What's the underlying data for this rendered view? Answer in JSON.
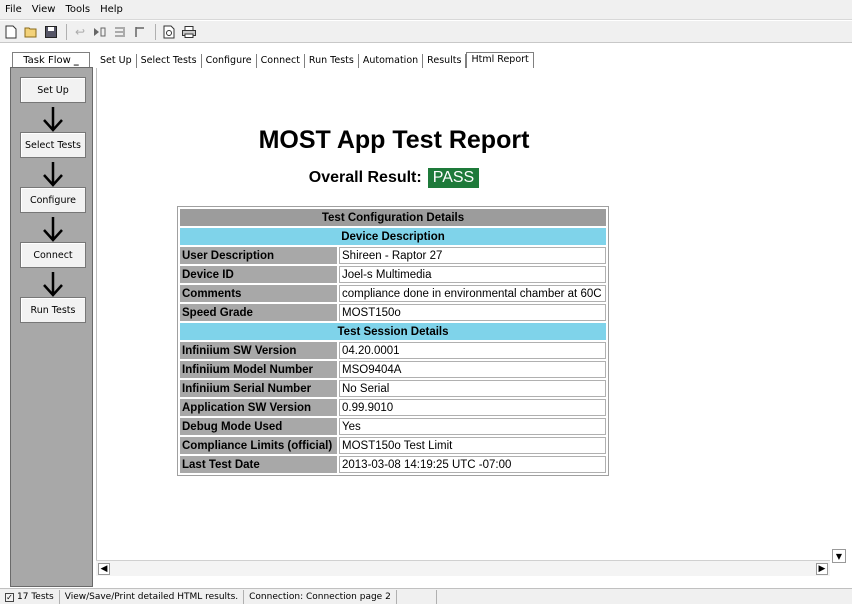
{
  "menu": [
    "File",
    "View",
    "Tools",
    "Help"
  ],
  "toolbar": {
    "icons": [
      "new-icon",
      "open-icon",
      "save-icon",
      "undo-icon",
      "run-icon",
      "stop-icon",
      "skip-icon",
      "print-preview-icon",
      "print-icon"
    ]
  },
  "taskflow": {
    "title": "Task Flow",
    "pin": "_",
    "steps": [
      "Set Up",
      "Select Tests",
      "Configure",
      "Connect",
      "Run Tests"
    ]
  },
  "tabs": [
    "Set Up",
    "Select Tests",
    "Configure",
    "Connect",
    "Run Tests",
    "Automation",
    "Results",
    "Html Report"
  ],
  "active_tab": "Html Report",
  "report": {
    "title": "MOST App Test Report",
    "result_label": "Overall Result:",
    "result_value": "PASS",
    "result_color": "#1e7a3a",
    "table_title": "Test Configuration Details",
    "sections": [
      {
        "title": "Device Description",
        "rows": [
          {
            "label": "User Description",
            "value": "Shireen - Raptor 27"
          },
          {
            "label": "Device ID",
            "value": "Joel-s Multimedia"
          },
          {
            "label": "Comments",
            "value": "compliance done in environmental chamber at 60C"
          },
          {
            "label": "Speed Grade",
            "value": "MOST150o"
          }
        ]
      },
      {
        "title": "Test Session Details",
        "rows": [
          {
            "label": "Infiniium SW Version",
            "value": "04.20.0001"
          },
          {
            "label": "Infiniium Model Number",
            "value": "MSO9404A"
          },
          {
            "label": "Infiniium Serial Number",
            "value": "No Serial"
          },
          {
            "label": "Application SW Version",
            "value": "0.99.9010"
          },
          {
            "label": "Debug Mode Used",
            "value": "Yes"
          },
          {
            "label": "Compliance Limits (official)",
            "value": "MOST150o Test Limit"
          },
          {
            "label": "Last Test Date",
            "value": "2013-03-08 14:19:25 UTC -07:00"
          }
        ]
      }
    ]
  },
  "status": {
    "tests": "17 Tests",
    "hint": "View/Save/Print detailed HTML results.",
    "connection": "Connection: Connection page 2"
  }
}
